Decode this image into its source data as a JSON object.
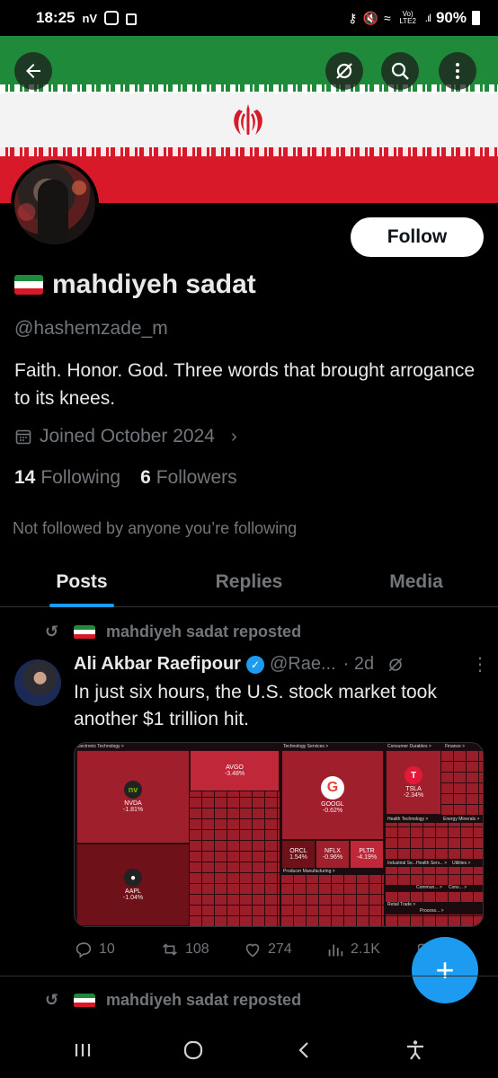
{
  "status_bar": {
    "time": "18:25",
    "battery": "90%",
    "network_label": "Vo) LTE2"
  },
  "profile": {
    "display_name": "mahdiyeh sadat",
    "handle": "@hashemzade_m",
    "bio": "Faith. Honor. God. Three words that brought arrogance to its knees.",
    "joined": "Joined October 2024",
    "following_count": "14",
    "following_label": "Following",
    "followers_count": "6",
    "followers_label": "Followers",
    "not_followed": "Not followed by anyone you’re following",
    "follow_button": "Follow"
  },
  "tabs": [
    {
      "label": "Posts",
      "active": true
    },
    {
      "label": "Replies",
      "active": false
    },
    {
      "label": "Media",
      "active": false
    }
  ],
  "post": {
    "repost_label": "mahdiyeh sadat reposted",
    "author": "Ali Akbar Raefipour",
    "handle": "@Rae...",
    "time": "· 2d",
    "text": "In just six hours, the U.S. stock market took another $1 trillion hit.",
    "replies": "10",
    "reposts": "108",
    "likes": "274",
    "views": "2.1K"
  },
  "next_post": {
    "repost_label": "mahdiyeh sadat reposted"
  },
  "treemap": {
    "sectors": [
      "Electronic Technology >",
      "Technology Services >",
      "Consumer Durables >",
      "Finance >",
      "Health Technology >",
      "Energy Minerals >",
      "Producer Manufacturing >",
      "Industrial Se... >",
      "Health Serv... >",
      "Utilities >",
      "Commun... >",
      "Cons... >",
      "Retail Trade >",
      "Process... >"
    ],
    "tiles": [
      {
        "ticker": "NVDA",
        "change": "-1.81%"
      },
      {
        "ticker": "AAPL",
        "change": "-1.04%"
      },
      {
        "ticker": "AVGO",
        "change": "-3.48%"
      },
      {
        "ticker": "GOOGL",
        "change": "-0.62%"
      },
      {
        "ticker": "TSLA",
        "change": "-2.34%"
      },
      {
        "ticker": "ORCL",
        "change": "1.54%"
      },
      {
        "ticker": "NFLX",
        "change": "-0.96%"
      },
      {
        "ticker": "PLTR",
        "change": "-4.19%"
      }
    ]
  },
  "colors": {
    "accent": "#1d9bf0",
    "background": "#000000",
    "muted": "#71767b",
    "treemap_red": "#8b1a26"
  },
  "icons": [
    "back-arrow-icon",
    "grok-icon",
    "search-icon",
    "more-vertical-icon",
    "calendar-icon",
    "chevron-right-icon",
    "repost-icon",
    "verified-icon",
    "reply-icon",
    "like-icon",
    "views-icon",
    "compose-plus-icon",
    "recents-icon",
    "home-icon",
    "back-nav-icon",
    "accessibility-icon"
  ]
}
